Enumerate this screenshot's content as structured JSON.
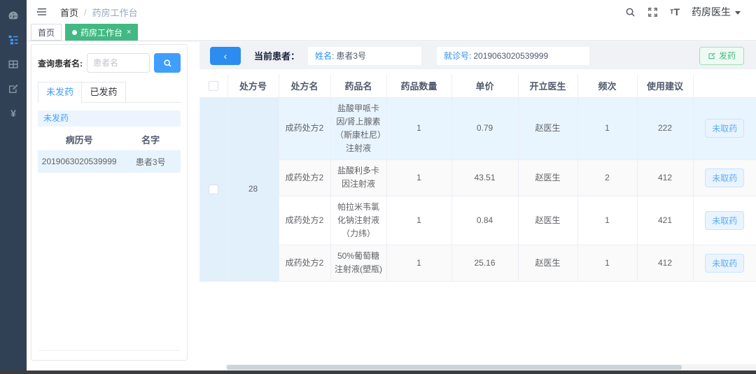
{
  "colors": {
    "sidebar_bg": "#304156",
    "accent_blue": "#409eff",
    "primary_blue": "#2d8cf0",
    "tag_green": "#42b983",
    "row_highlight": "#e9f5fe",
    "merged_cell_bg": "#e2f0fc"
  },
  "sidebar": {
    "items": [
      {
        "icon": "dashboard-icon",
        "active": false
      },
      {
        "icon": "tree-menu-icon",
        "active": true
      },
      {
        "icon": "table-icon",
        "active": false
      },
      {
        "icon": "edit-icon",
        "active": false
      },
      {
        "icon": "currency-yen-icon",
        "active": false,
        "glyph": "¥"
      }
    ]
  },
  "navbar": {
    "breadcrumb": {
      "home": "首页",
      "separator": "/",
      "current": "药房工作台"
    },
    "font_tool": {
      "small": "T",
      "big": "T"
    },
    "user": {
      "name": "药房医生"
    }
  },
  "tagbar": {
    "tags": [
      {
        "label": "首页",
        "active": false
      },
      {
        "label": "药房工作台",
        "active": true,
        "close": "×"
      }
    ]
  },
  "patient_panel": {
    "search_label": "查询患者名:",
    "search_placeholder": "患者名",
    "tabs": [
      {
        "label": "未发药",
        "active": true
      },
      {
        "label": "已发药",
        "active": false
      }
    ],
    "section_header": "未发药",
    "table": {
      "headers": [
        "病历号",
        "名字"
      ],
      "rows": [
        {
          "record_no": "2019063020539999",
          "name": "患者3号"
        }
      ]
    }
  },
  "main": {
    "back_button": "‹",
    "current_patient_label": "当前患者：",
    "name_label": "姓名:",
    "name_value": "患者3号",
    "visit_label": "就诊号:",
    "visit_value": "2019063020539999",
    "dispense_button": "发药",
    "table": {
      "headers": [
        "",
        "处方号",
        "处方名",
        "药品名",
        "药品数量",
        "单价",
        "开立医生",
        "频次",
        "使用建议",
        ""
      ],
      "prescription_no": "28",
      "rows": [
        {
          "type": "成药处方2",
          "drug": "盐酸甲哌卡因/肾上腺素（斯康杜尼）注射液",
          "qty": "1",
          "price": "0.79",
          "doctor": "赵医生",
          "freq": "1",
          "advice": "222",
          "status": "未取药"
        },
        {
          "type": "成药处方2",
          "drug": "盐酸利多卡因注射液",
          "qty": "1",
          "price": "43.51",
          "doctor": "赵医生",
          "freq": "2",
          "advice": "412",
          "status": "未取药"
        },
        {
          "type": "成药处方2",
          "drug": "帕拉米韦氯化钠注射液（力纬）",
          "qty": "1",
          "price": "0.84",
          "doctor": "赵医生",
          "freq": "1",
          "advice": "421",
          "status": "未取药"
        },
        {
          "type": "成药处方2",
          "drug": "50%葡萄糖注射液(塑瓶)",
          "qty": "1",
          "price": "25.16",
          "doctor": "赵医生",
          "freq": "1",
          "advice": "412",
          "status": "未取药"
        }
      ]
    }
  }
}
